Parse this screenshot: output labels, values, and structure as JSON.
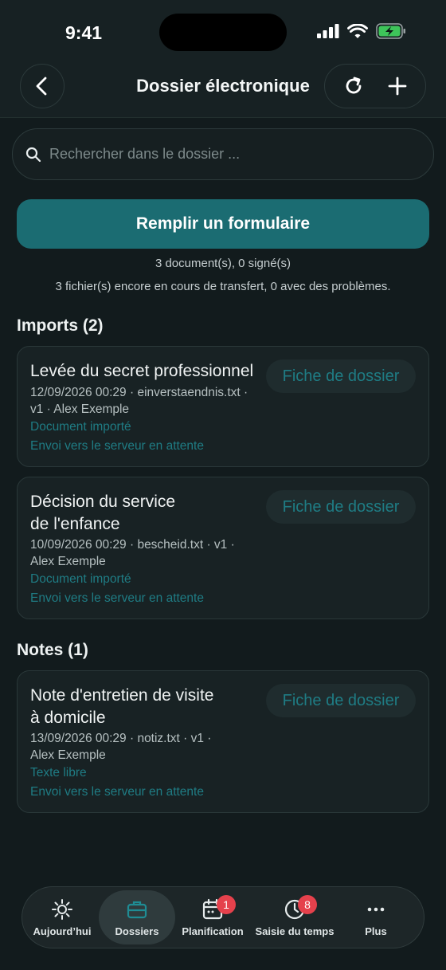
{
  "status_bar": {
    "time": "9:41"
  },
  "header": {
    "title": "Dossier électronique"
  },
  "search": {
    "placeholder": "Rechercher dans le dossier ..."
  },
  "primary_action": {
    "label": "Remplir un formulaire"
  },
  "summary": {
    "documents": "3 document(s), 0 signé(s)",
    "transfers": "3 fichier(s) encore en cours de transfert, 0 avec des problèmes."
  },
  "sections": {
    "imports": {
      "title": "Imports (2)",
      "items": [
        {
          "title": "Levée du secret professionnel",
          "meta_line1": "12/09/2026 00:29 · einverstaendnis.txt ·",
          "meta_line2": "v1 · Alex Exemple",
          "type": "Document importé",
          "status": "Envoi vers le serveur en attente",
          "button": "Fiche de dossier"
        },
        {
          "title_line1": "Décision du service",
          "title_line2": "de l'enfance",
          "meta_line1": "10/09/2026 00:29 · bescheid.txt · v1 ·",
          "meta_line2": "Alex Exemple",
          "type": "Document importé",
          "status": "Envoi vers le serveur en attente",
          "button": "Fiche de dossier"
        }
      ]
    },
    "notes": {
      "title": "Notes (1)",
      "items": [
        {
          "title_line1": "Note d'entretien de visite",
          "title_line2": "à domicile",
          "meta_line1": "13/09/2026 00:29 · notiz.txt · v1 ·",
          "meta_line2": "Alex Exemple",
          "type": "Texte libre",
          "status": "Envoi vers le serveur en attente",
          "button": "Fiche de dossier"
        }
      ]
    }
  },
  "tabbar": {
    "items": [
      {
        "label": "Aujourd’hui",
        "icon": "sun-icon"
      },
      {
        "label": "Dossiers",
        "icon": "briefcase-icon",
        "active": true
      },
      {
        "label": "Planification",
        "icon": "calendar-icon",
        "badge": "1"
      },
      {
        "label": "Saisie du temps",
        "icon": "clock-icon",
        "badge": "8"
      },
      {
        "label": "Plus",
        "icon": "more-icon"
      }
    ]
  },
  "colors": {
    "accent": "#1b6c72",
    "link": "#1f7c84",
    "badge": "#e5414c",
    "background": "#121b1d"
  }
}
